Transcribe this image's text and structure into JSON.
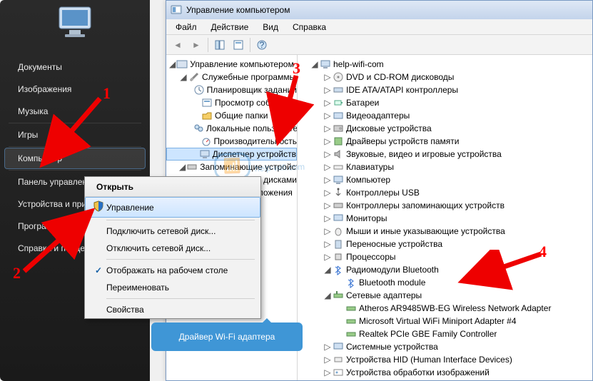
{
  "start_menu": {
    "items": [
      {
        "label": "Документы"
      },
      {
        "label": "Изображения"
      },
      {
        "label": "Музыка"
      },
      {
        "label": "Игры"
      },
      {
        "label": "Компьютер"
      },
      {
        "label": "Панель управления"
      },
      {
        "label": "Устройства и принтеры"
      },
      {
        "label": "Программы по умолчанию"
      },
      {
        "label": "Справка и поддержка"
      }
    ]
  },
  "context_menu": {
    "title": "Открыть",
    "items": [
      {
        "label": "Управление",
        "highlight": true,
        "icon": "shield"
      },
      {
        "label": "Подключить сетевой диск..."
      },
      {
        "label": "Отключить сетевой диск..."
      },
      {
        "label": "Отображать на рабочем столе",
        "checked": true
      },
      {
        "label": "Переименовать"
      },
      {
        "label": "Свойства"
      }
    ]
  },
  "window": {
    "title": "Управление компьютером",
    "menu": {
      "file": "Файл",
      "action": "Действие",
      "view": "Вид",
      "help": "Справка"
    }
  },
  "left_tree": {
    "root": "Управление компьютером (локальным)",
    "nodes": [
      {
        "label": "Служебные программы",
        "expanded": true,
        "children": [
          {
            "label": "Планировщик заданий"
          },
          {
            "label": "Просмотр событий"
          },
          {
            "label": "Общие папки"
          },
          {
            "label": "Локальные пользователи"
          },
          {
            "label": "Производительность"
          },
          {
            "label": "Диспетчер устройств",
            "selected": true
          }
        ]
      },
      {
        "label": "Запоминающие устройства",
        "expanded": true,
        "children": [
          {
            "label": "Управление дисками"
          }
        ]
      },
      {
        "label": "Службы и приложения"
      }
    ]
  },
  "right_tree": {
    "root": "help-wifi-com",
    "nodes": [
      {
        "label": "DVD и CD-ROM дисководы"
      },
      {
        "label": "IDE ATA/ATAPI контроллеры"
      },
      {
        "label": "Батареи"
      },
      {
        "label": "Видеоадаптеры"
      },
      {
        "label": "Дисковые устройства"
      },
      {
        "label": "Драйверы устройств памяти"
      },
      {
        "label": "Звуковые, видео и игровые устройства"
      },
      {
        "label": "Клавиатуры"
      },
      {
        "label": "Компьютер"
      },
      {
        "label": "Контроллеры USB"
      },
      {
        "label": "Контроллеры запоминающих устройств"
      },
      {
        "label": "Мониторы"
      },
      {
        "label": "Мыши и иные указывающие устройства"
      },
      {
        "label": "Переносные устройства"
      },
      {
        "label": "Процессоры"
      },
      {
        "label": "Радиомодули Bluetooth",
        "expanded": true,
        "children": [
          {
            "label": "Bluetooth module"
          }
        ]
      },
      {
        "label": "Сетевые адаптеры",
        "expanded": true,
        "children": [
          {
            "label": "Atheros AR9485WB-EG Wireless Network Adapter"
          },
          {
            "label": "Microsoft Virtual WiFi Miniport Adapter #4"
          },
          {
            "label": "Realtek PCIe GBE Family Controller"
          }
        ]
      },
      {
        "label": "Системные устройства"
      },
      {
        "label": "Устройства HID (Human Interface Devices)"
      },
      {
        "label": "Устройства обработки изображений"
      }
    ]
  },
  "annotations": {
    "n1": "1",
    "n2": "2",
    "n3": "3",
    "n4": "4",
    "callout": "Драйвер Wi-Fi адаптера",
    "watermark": "help-wifi.com"
  }
}
